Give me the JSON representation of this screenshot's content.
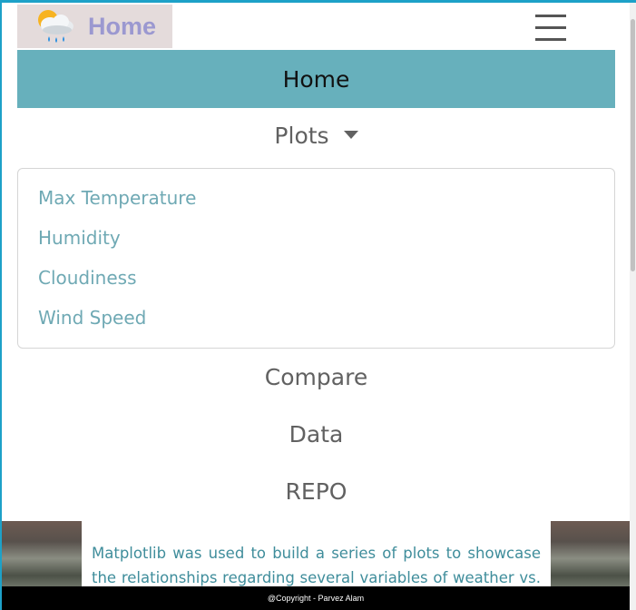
{
  "brand": {
    "title": "Home",
    "icon": "weather-cloud-rain-icon"
  },
  "nav": {
    "home": "Home",
    "plots": "Plots",
    "plots_menu": [
      "Max Temperature",
      "Humidity",
      "Cloudiness",
      "Wind Speed"
    ],
    "compare": "Compare",
    "data": "Data",
    "repo": "REPO"
  },
  "content": {
    "description": "Matplotlib was used to build a series of plots to showcase the relationships regarding several variables of weather vs. latitude."
  },
  "footer": {
    "text": "@Copyright - Parvez Alam"
  },
  "colors": {
    "accent": "#67b0bc",
    "brand_bg": "#e4dbdb",
    "brand_text": "#9b98d0",
    "link": "#6fa9b4",
    "footer_bg": "#000000"
  }
}
